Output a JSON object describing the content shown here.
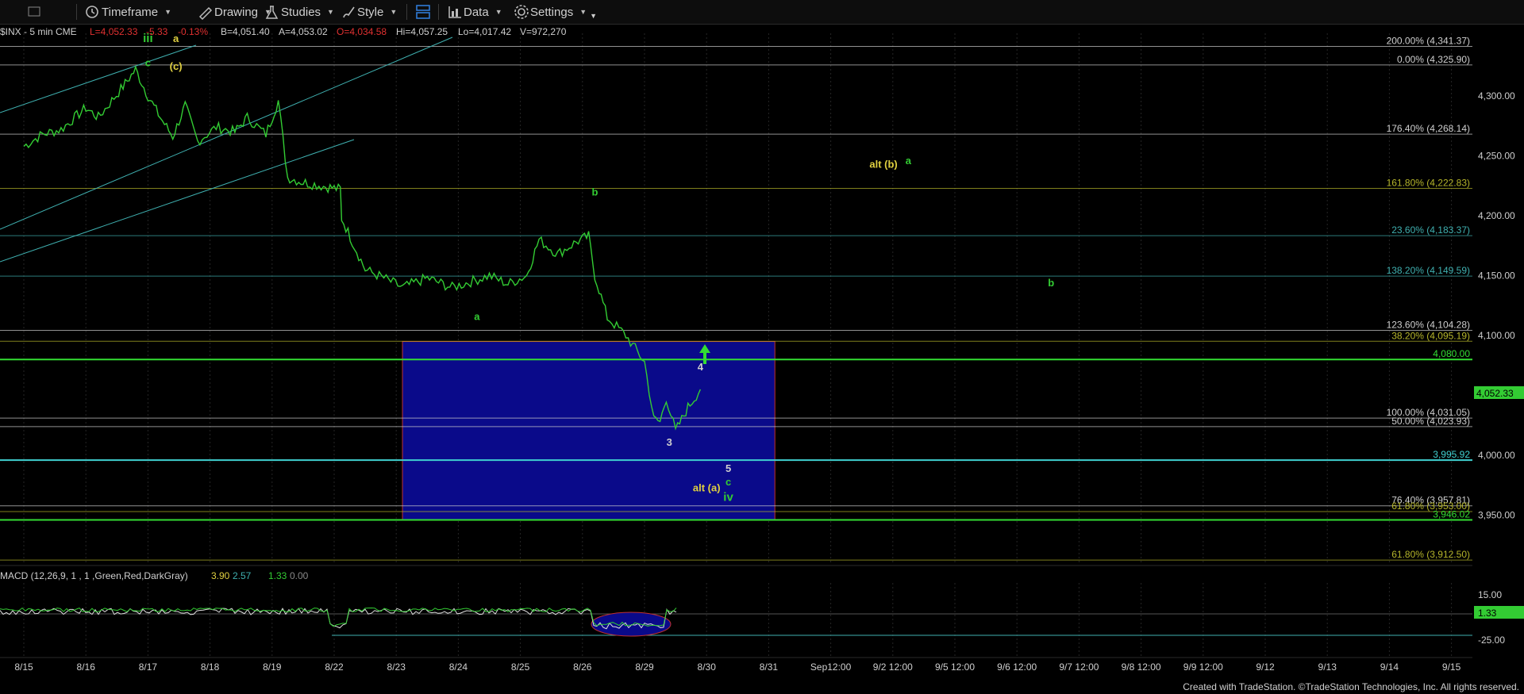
{
  "toolbar": {
    "timeframe": "Timeframe",
    "drawing": "Drawing",
    "studies": "Studies",
    "style": "Style",
    "data": "Data",
    "settings": "Settings"
  },
  "header": {
    "symbol": "$INX - 5 min  CME",
    "last": "L=4,052.33",
    "change": "-5.33",
    "change_pct": "-0.13%",
    "bid": "B=4,051.40",
    "ask": "A=4,053.02",
    "open": "O=4,034.58",
    "high": "Hi=4,057.25",
    "low": "Lo=4,017.42",
    "volume": "V=972,270"
  },
  "macd": {
    "label": "MACD (12,26,9, 1 , 1 ,Green,Red,DarkGray)",
    "v1": "3.90",
    "v2": "2.57",
    "v3": "1.33",
    "v4": "0.00",
    "axis": [
      "15.00",
      "-25.00"
    ],
    "current": "1.33"
  },
  "footer": "Created with TradeStation. ©TradeStation Technologies, Inc. All rights reserved.",
  "chart_data": {
    "type": "line",
    "symbol": "$INX",
    "interval": "5 min",
    "x_categories": [
      "8/15",
      "8/16",
      "8/17",
      "8/18",
      "8/19",
      "8/22",
      "8/23",
      "8/24",
      "8/25",
      "8/26",
      "8/29",
      "8/30",
      "8/31",
      "Sep12:00",
      "9/2 12:00",
      "9/5 12:00",
      "9/6 12:00",
      "9/7 12:00",
      "9/8 12:00",
      "9/9 12:00",
      "9/12",
      "9/13",
      "9/14",
      "9/15"
    ],
    "y_ticks": [
      "4,300.00",
      "4,250.00",
      "4,200.00",
      "4,150.00",
      "4,100.00",
      "4,000.00",
      "3,950.00"
    ],
    "ylim": [
      3900,
      4360
    ],
    "current_price": "4,052.33",
    "price_path": [
      [
        0,
        4258
      ],
      [
        0.3,
        4268
      ],
      [
        0.6,
        4272
      ],
      [
        1.0,
        4290
      ],
      [
        1.2,
        4282
      ],
      [
        1.6,
        4308
      ],
      [
        1.8,
        4322
      ],
      [
        2.0,
        4300
      ],
      [
        2.2,
        4282
      ],
      [
        2.4,
        4266
      ],
      [
        2.6,
        4292
      ],
      [
        2.8,
        4262
      ],
      [
        3.1,
        4274
      ],
      [
        3.4,
        4270
      ],
      [
        3.6,
        4282
      ],
      [
        3.9,
        4268
      ],
      [
        4.1,
        4296
      ],
      [
        4.25,
        4232
      ],
      [
        4.5,
        4228
      ],
      [
        4.9,
        4224
      ],
      [
        5.1,
        4222
      ],
      [
        5.12,
        4198
      ],
      [
        5.5,
        4155
      ],
      [
        5.8,
        4148
      ],
      [
        6.1,
        4140
      ],
      [
        6.5,
        4148
      ],
      [
        6.9,
        4140
      ],
      [
        7.2,
        4145
      ],
      [
        7.5,
        4150
      ],
      [
        7.8,
        4143
      ],
      [
        8.1,
        4150
      ],
      [
        8.3,
        4180
      ],
      [
        8.6,
        4168
      ],
      [
        8.9,
        4178
      ],
      [
        9.1,
        4183
      ],
      [
        9.2,
        4150
      ],
      [
        9.4,
        4115
      ],
      [
        9.7,
        4100
      ],
      [
        10.0,
        4078
      ],
      [
        10.15,
        4030
      ],
      [
        10.25,
        4028
      ],
      [
        10.35,
        4048
      ],
      [
        10.5,
        4020
      ],
      [
        10.7,
        4040
      ],
      [
        10.9,
        4055
      ]
    ],
    "fib_levels": [
      {
        "label": "200.00% (4,341.37)",
        "value": 4341.37,
        "color": "#cfcfcf"
      },
      {
        "label": "0.00% (4,325.90)",
        "value": 4325.9,
        "color": "#cfcfcf"
      },
      {
        "label": "176.40% (4,268.14)",
        "value": 4268.14,
        "color": "#cfcfcf"
      },
      {
        "label": "161.80% (4,222.83)",
        "value": 4222.83,
        "color": "#b5b52a"
      },
      {
        "label": "23.60% (4,183.37)",
        "value": 4183.37,
        "color": "#3fb0b0"
      },
      {
        "label": "138.20% (4,149.59)",
        "value": 4149.59,
        "color": "#3fb0b0"
      },
      {
        "label": "123.60% (4,104.28)",
        "value": 4104.28,
        "color": "#cfcfcf"
      },
      {
        "label": "38.20% (4,095.19)",
        "value": 4095.19,
        "color": "#b5b52a"
      },
      {
        "label": "4,080.00",
        "value": 4080.0,
        "color": "#33dd33"
      },
      {
        "label": "100.00% (4,031.05)",
        "value": 4031.05,
        "color": "#cfcfcf"
      },
      {
        "label": "50.00% (4,023.93)",
        "value": 4023.93,
        "color": "#cfcfcf"
      },
      {
        "label": "3,995.92",
        "value": 3995.92,
        "color": "#40d0d0"
      },
      {
        "label": "76.40% (3,957.81)",
        "value": 3957.81,
        "color": "#cfcfcf"
      },
      {
        "label": "61.80% (3,953.00)",
        "value": 3953.0,
        "color": "#b5b52a"
      },
      {
        "label": "3,946.02",
        "value": 3946.02,
        "color": "#33dd33"
      },
      {
        "label": "61.80% (3,912.50)",
        "value": 3912.5,
        "color": "#b5b52a"
      }
    ],
    "wave_labels": [
      {
        "text": "iii",
        "x": 2.0,
        "y": 4345,
        "color": "#33cc33"
      },
      {
        "text": "a",
        "x": 2.45,
        "y": 4345,
        "color": "#e0d040"
      },
      {
        "text": "c",
        "x": 2.0,
        "y": 4325,
        "color": "#33cc33"
      },
      {
        "text": "(c)",
        "x": 2.45,
        "y": 4322,
        "color": "#e0d040"
      },
      {
        "text": "a",
        "x": 7.3,
        "y": 4113,
        "color": "#33cc33"
      },
      {
        "text": "b",
        "x": 9.2,
        "y": 4217,
        "color": "#33cc33"
      },
      {
        "text": "3",
        "x": 10.4,
        "y": 4008,
        "color": "#cfcfcf"
      },
      {
        "text": "4",
        "x": 10.9,
        "y": 4071,
        "color": "#cfcfcf"
      },
      {
        "text": "5",
        "x": 11.35,
        "y": 3986,
        "color": "#cfcfcf"
      },
      {
        "text": "c",
        "x": 11.35,
        "y": 3975,
        "color": "#33cc33"
      },
      {
        "text": "iv",
        "x": 11.35,
        "y": 3962,
        "color": "#33cc33"
      },
      {
        "text": "alt (a)",
        "x": 11.0,
        "y": 3970,
        "color": "#e0d040"
      },
      {
        "text": "alt (b)",
        "x": 13.85,
        "y": 4240,
        "color": "#e0d040"
      },
      {
        "text": "a",
        "x": 14.25,
        "y": 4243,
        "color": "#33cc33"
      },
      {
        "text": "b",
        "x": 16.55,
        "y": 4141,
        "color": "#33cc33"
      }
    ],
    "target_box": {
      "x_from": 6.1,
      "x_to": 12.1,
      "y_from": 3946,
      "y_to": 4095
    }
  }
}
